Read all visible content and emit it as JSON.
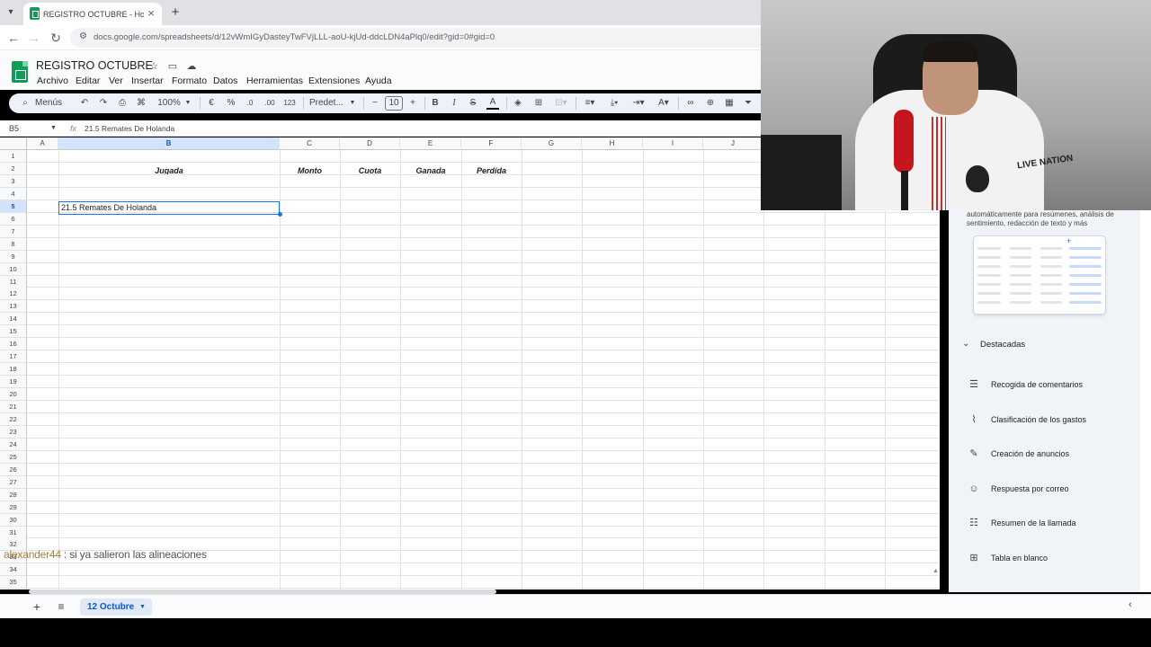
{
  "browser": {
    "tab_title": "REGISTRO OCTUBRE - Hojas de",
    "url": "docs.google.com/spreadsheets/d/12vWmIGyDasteyTwFVjLLL-aoU-kjUd-ddcLDN4aPlq0/edit?gid=0#gid=0"
  },
  "doc": {
    "title": "REGISTRO OCTUBRE",
    "menu": [
      "Archivo",
      "Editar",
      "Ver",
      "Insertar",
      "Formato",
      "Datos",
      "Herramientas",
      "Extensiones",
      "Ayuda"
    ]
  },
  "toolbar": {
    "search_label": "Menús",
    "zoom": "100%",
    "currency": "€",
    "percent": "%",
    "dec_less": ".0",
    "dec_more": ".00",
    "number_format": "123",
    "font": "Predet...",
    "font_size": "10",
    "bold": "B",
    "italic": "I",
    "strike": "S",
    "text_color": "A"
  },
  "formula_bar": {
    "cell_ref": "B5",
    "fx": "fx",
    "content": "21.5 Remates De Holanda"
  },
  "grid": {
    "columns": [
      "A",
      "B",
      "C",
      "D",
      "E",
      "F",
      "G",
      "H",
      "I",
      "J"
    ],
    "selected_column": "B",
    "rows": [
      "1",
      "2",
      "3",
      "4",
      "5",
      "6",
      "7",
      "8",
      "9",
      "10",
      "11",
      "12",
      "13",
      "14",
      "15",
      "16",
      "17",
      "18",
      "19",
      "20",
      "21",
      "22",
      "23",
      "24",
      "25",
      "26",
      "27",
      "28",
      "29",
      "30",
      "31",
      "32",
      "33",
      "34",
      "35"
    ],
    "selected_row": "5",
    "headers_row2": {
      "B": "Jugada",
      "C": "Monto",
      "D": "Cuota",
      "E": "Ganada",
      "F": "Perdida"
    },
    "active_cell_value": "21.5 Remates De Holanda"
  },
  "chat_overlay": {
    "user": "alexander44",
    "message": " : si ya salieron las alineaciones"
  },
  "side_panel": {
    "description": "automáticamente para resúmenes, análisis de sentimiento, redacción de texto y más",
    "section_title": "Destacadas",
    "items": [
      {
        "label": "Recogida de comentarios",
        "icon": "feedback-form-icon"
      },
      {
        "label": "Clasificación de los gastos",
        "icon": "chart-icon"
      },
      {
        "label": "Creación de anuncios",
        "icon": "magic-wand-icon"
      },
      {
        "label": "Respuesta por correo",
        "icon": "person-reply-icon"
      },
      {
        "label": "Resumen de la llamada",
        "icon": "summary-icon"
      },
      {
        "label": "Tabla en blanco",
        "icon": "table-icon"
      }
    ]
  },
  "bottom": {
    "sheet_tab": "12 Octubre"
  },
  "webcam": {
    "shirt_text": "LIVE NATION"
  }
}
